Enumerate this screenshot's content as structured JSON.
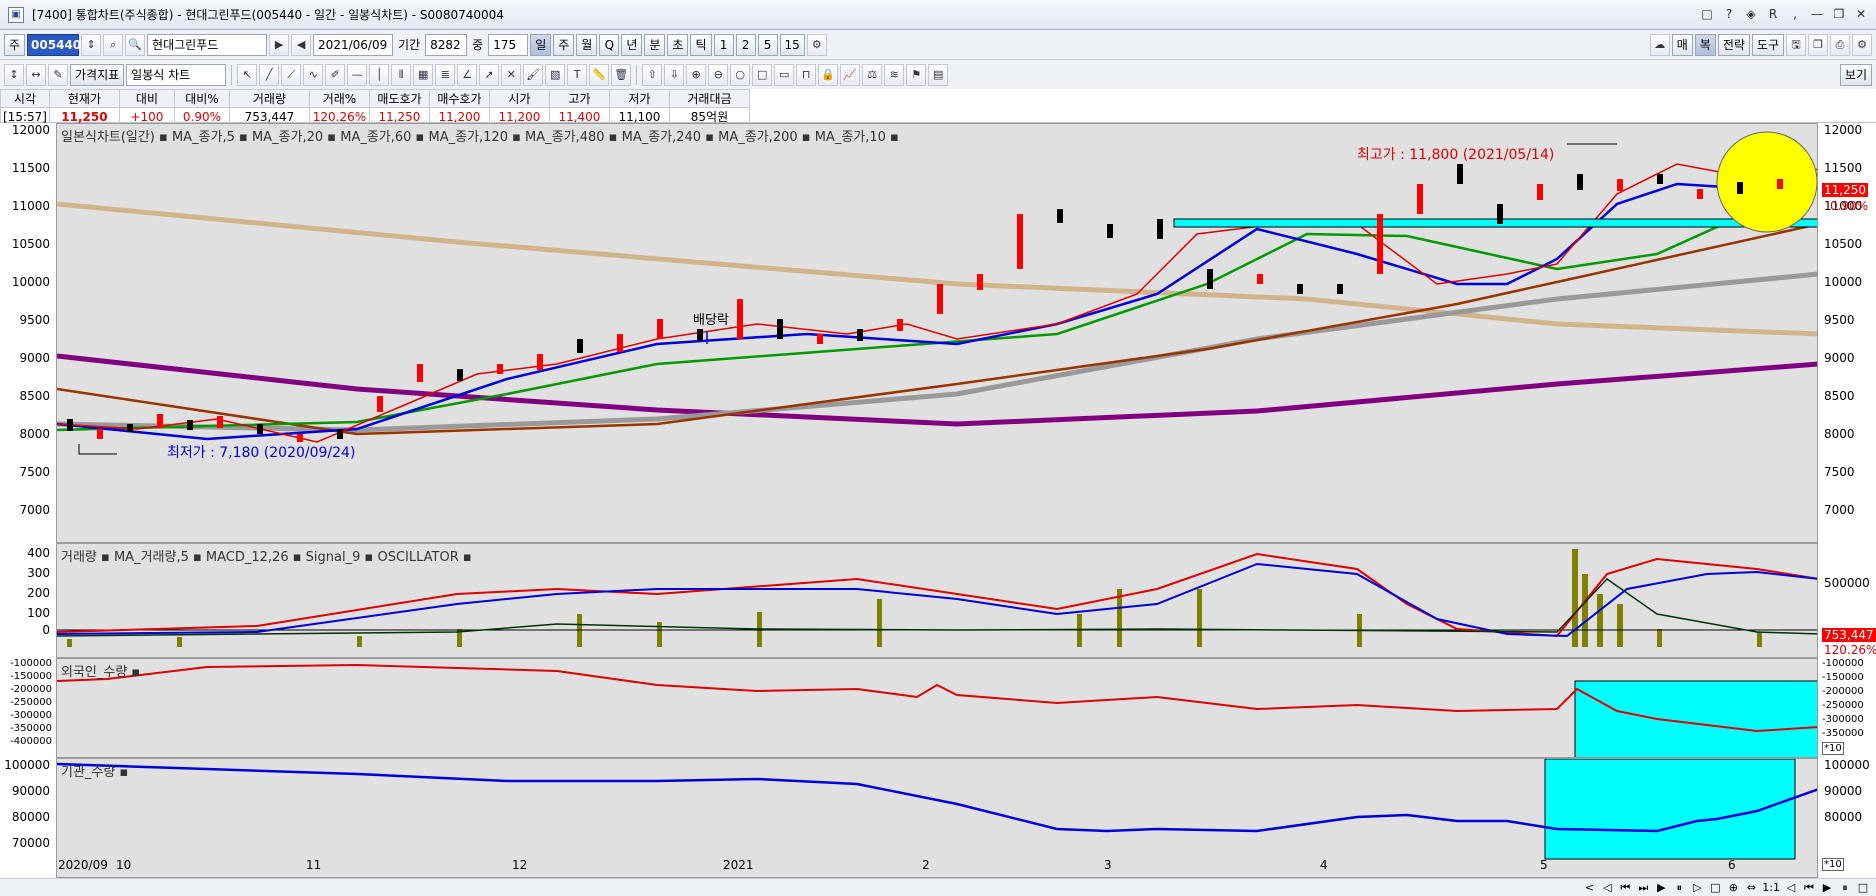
{
  "window": {
    "title": "[7400] 통합차트(주식종합) - 현대그린푸드(005440 - 일간 - 일봉식차트) - S0080740004",
    "controls": [
      "□",
      "?",
      "◈",
      "R",
      ",",
      "—",
      "❐",
      "✕"
    ]
  },
  "toolbar1": {
    "type_label": "주",
    "code": "005440",
    "stock_name": "현대그린푸드",
    "date": "2021/06/09",
    "period_label": "기간",
    "period_value": "8282",
    "count_label": "중",
    "count_value": "175",
    "interval_buttons": [
      "일",
      "주",
      "월",
      "Q",
      "년",
      "분",
      "초",
      "틱",
      "1",
      "2",
      "5",
      "15"
    ],
    "right_buttons": [
      "매",
      "복",
      "전략",
      "도구"
    ]
  },
  "toolbar2": {
    "indicator_button": "가격지표",
    "chart_type": "일봉식 차트",
    "view_button": "보기"
  },
  "quote": {
    "headers": [
      "시각",
      "현재가",
      "대비",
      "대비%",
      "거래량",
      "거래%",
      "매도호가",
      "매수호가",
      "시가",
      "고가",
      "저가",
      "거래대금"
    ],
    "values": [
      "[15:57]",
      "11,250",
      "+100",
      "0.90%",
      "753,447",
      "120.26%",
      "11,250",
      "11,200",
      "11,200",
      "11,400",
      "11,100",
      "85억원"
    ]
  },
  "price_panel": {
    "legend": "일본식차트(일간) ▪ MA_종가,5 ▪ MA_종가,20 ▪ MA_종가,60 ▪ MA_종가,120 ▪ MA_종가,480 ▪ MA_종가,240 ▪ MA_종가,200 ▪ MA_종가,10 ▪",
    "yticks": [
      "12000",
      "11500",
      "11000",
      "10500",
      "10000",
      "9500",
      "9000",
      "8500",
      "8000",
      "7500",
      "7000"
    ],
    "high_annotation": "최고가 : 11,800 (2021/05/14)",
    "low_annotation": "최저가 : 7,180 (2020/09/24)",
    "dividend_label": "배당락",
    "current_price_tag": "11,250",
    "current_change_tag": "0.90%"
  },
  "volume_panel": {
    "legend": "거래량 ▪ MA_거래량,5 ▪ MACD_12,26 ▪ Signal_9 ▪ OSCILLATOR ▪",
    "yticks_left": [
      "400",
      "300",
      "200",
      "100",
      "0"
    ],
    "yticks_right": [
      "500000"
    ],
    "volume_tag": "753,447",
    "volume_pct_tag": "120.26%"
  },
  "foreign_panel": {
    "legend": "외국인_수량 ▪",
    "yticks": [
      "-100000",
      "-150000",
      "-200000",
      "-250000",
      "-300000",
      "-350000",
      "-400000"
    ],
    "yticks_right": [
      "-100000",
      "-150000",
      "-200000",
      "-250000",
      "-300000",
      "-350000"
    ],
    "scale_tag": "*10"
  },
  "institution_panel": {
    "legend": "기관_수량 ▪",
    "yticks": [
      "100000",
      "90000",
      "80000",
      "70000"
    ],
    "yticks_right": [
      "100000",
      "90000",
      "80000"
    ],
    "scale_tag": "*10"
  },
  "xaxis": {
    "labels": [
      "2020/09",
      "10",
      "11",
      "12",
      "2021",
      "2",
      "3",
      "4",
      "5",
      "6"
    ]
  },
  "statusbar": {
    "items": [
      "<",
      "◁",
      "⏮",
      "⏭",
      "▶",
      "⏸",
      "▷",
      "□",
      "⊕",
      "⇔",
      "1:1",
      "◁",
      "⏮",
      "▶",
      "⏸",
      "□"
    ]
  },
  "colors": {
    "ma5": "#e00000",
    "ma20": "#0000dd",
    "ma60": "#009900",
    "ma120": "#993300",
    "ma480": "#d2b48c",
    "ma240": "#999999",
    "ma200": "#800080",
    "ma10": "#000066",
    "up": "#ff0000",
    "down": "#000000",
    "highlight": "#00ffff",
    "circle": "#ffff00"
  }
}
